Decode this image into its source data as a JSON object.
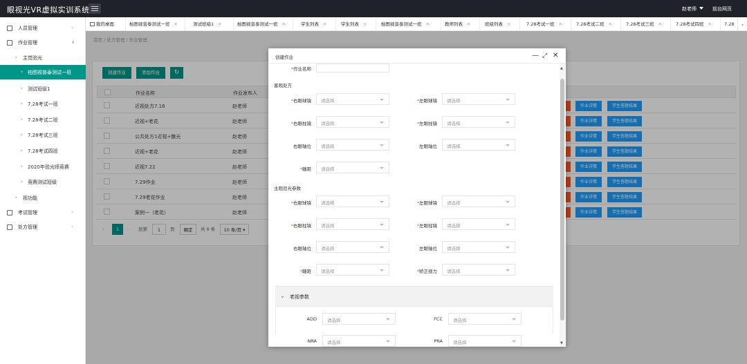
{
  "app": {
    "title": "眼视光VR虚拟实训系统"
  },
  "header": {
    "user": "赵老师",
    "back_link": "前台网页"
  },
  "sidebar": {
    "items": [
      {
        "label": "人员管理",
        "icon": "users-icon",
        "chevron": "‹"
      },
      {
        "label": "作业管理",
        "icon": "document-icon",
        "chevron": "∨"
      },
      {
        "label": "主觉验光"
      },
      {
        "label": "柏图视普泰测试一班",
        "active": true
      },
      {
        "label": "测试班级1"
      },
      {
        "label": "7.28考试一班"
      },
      {
        "label": "7.28考试二班"
      },
      {
        "label": "7.28考试三班"
      },
      {
        "label": "7.28考试四班"
      },
      {
        "label": "2020年验光师竞赛"
      },
      {
        "label": "竞赛测试班级"
      },
      {
        "label": "视功能"
      },
      {
        "label": "考试管理",
        "icon": "exam-icon",
        "chevron": "‹"
      },
      {
        "label": "处方管理",
        "icon": "prescription-icon",
        "chevron": "‹"
      }
    ]
  },
  "tabs": [
    {
      "label": "我的桌面"
    },
    {
      "label": "柏图视普泰测试一班"
    },
    {
      "label": "测试班级1"
    },
    {
      "label": "柏图视普泰测试一班"
    },
    {
      "label": "学生列表"
    },
    {
      "label": "学生列表"
    },
    {
      "label": "柏图视普泰测试一班"
    },
    {
      "label": "教师列表"
    },
    {
      "label": "班级列表"
    },
    {
      "label": "7.28考试一班"
    },
    {
      "label": "7.28考试二班"
    },
    {
      "label": "7.28考试三班"
    },
    {
      "label": "7.28考试四班"
    },
    {
      "label": "7.28"
    }
  ],
  "breadcrumb": {
    "text": "首页 / 处方管理 / 作业管理"
  },
  "toolbar": {
    "create_label": "创建作业",
    "add_label": "添加作业"
  },
  "table": {
    "headers": [
      "作业名称",
      "作业发布人"
    ],
    "rows": [
      {
        "name": "近视处方7.16",
        "publisher": "赵老师"
      },
      {
        "name": "近视+老花",
        "publisher": "赵老师"
      },
      {
        "name": "公共处方1近视+散光",
        "publisher": "赵老师"
      },
      {
        "name": "近视+老花",
        "publisher": "赵老师"
      },
      {
        "name": "近视7.22",
        "publisher": "赵老师"
      },
      {
        "name": "7.29作业",
        "publisher": "赵老师"
      },
      {
        "name": "7.29老花作业",
        "publisher": "赵老师"
      },
      {
        "name": "案例一（老花）",
        "publisher": "赵老师"
      }
    ],
    "action_detail": "作业详情",
    "action_results": "学生答题结果"
  },
  "pager": {
    "current": "1",
    "goto_label": "到第",
    "page_value": "1",
    "page_unit": "页",
    "confirm": "确定",
    "total": "共 8 条",
    "page_size": "10 条/页"
  },
  "modal": {
    "title": "创建作业",
    "name_label": "作业名称",
    "placeholder": "请选择",
    "section1": "客观处方",
    "section2": "主观验光参数",
    "labels": {
      "r_sph": "右眼球镜",
      "l_sph": "左眼球镜",
      "r_cyl": "右眼柱镜",
      "l_cyl": "左眼柱镜",
      "r_axis": "右眼轴位",
      "l_axis": "左眼轴位",
      "pd": "瞳距",
      "corrected_va": "矫正视力"
    },
    "collapse_title": "老视参数",
    "presbyopia": {
      "add": "ADD",
      "fcc": "FCC",
      "nra": "NRA",
      "pra": "PRA"
    }
  }
}
